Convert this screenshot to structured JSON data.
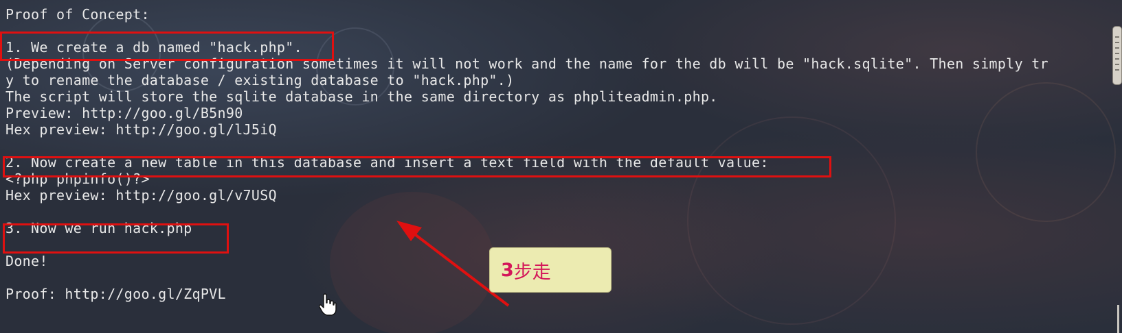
{
  "terminal": {
    "lines": [
      "Proof of Concept:",
      "1. We create a db named \"hack.php\".",
      "(Depending on Server configuration sometimes it will not work and the name for the db will be \"hack.sqlite\". Then simply tr",
      "y to rename the database / existing database to \"hack.php\".)",
      "The script will store the sqlite database in the same directory as phpliteadmin.php.",
      "Preview: http://goo.gl/B5n90",
      "Hex preview: http://goo.gl/lJ5iQ",
      "2. Now create a new table in this database and insert a text field with the default value:",
      "<?php phpinfo()?>",
      "Hex preview: http://goo.gl/v7USQ",
      "3. Now we run hack.php",
      "Done!",
      "Proof: http://goo.gl/ZqPVL"
    ]
  },
  "annotation": {
    "callout_number": "3",
    "callout_text": "步走",
    "highlight_color": "#e01010",
    "arrow_color": "#e01010",
    "callout_bg": "#ecebb1",
    "callout_text_color": "#d4175a"
  },
  "icons": {
    "cursor": "hand-pointer-icon"
  }
}
